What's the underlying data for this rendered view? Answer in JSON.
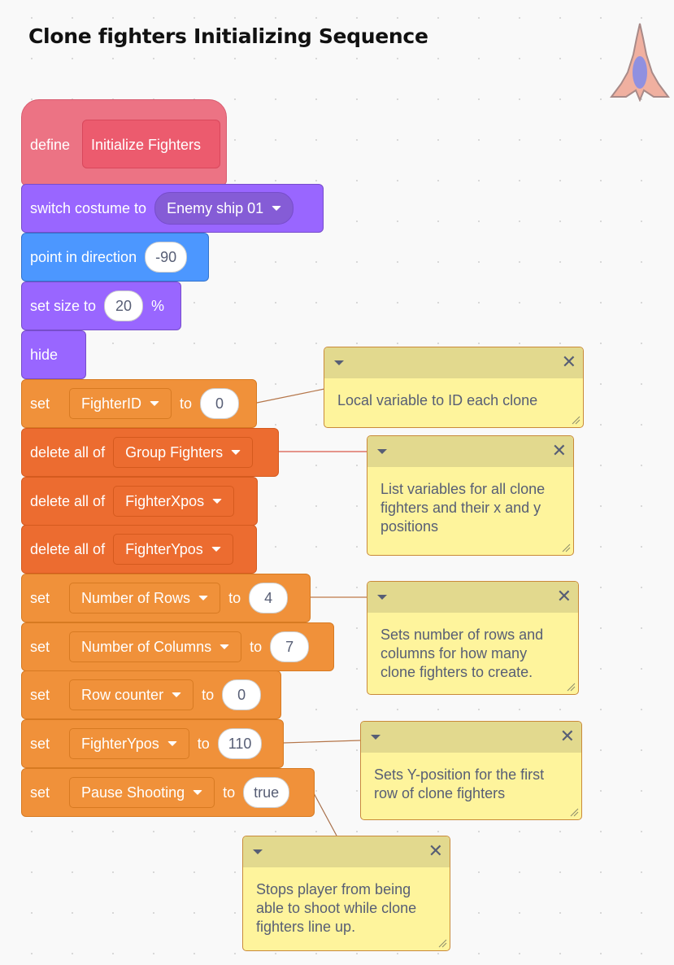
{
  "page": {
    "title": "Clone fighters Initializing Sequence"
  },
  "sprite": {
    "icon": "enemy-ship-sprite"
  },
  "script": {
    "define": {
      "label": "define",
      "name": "Initialize Fighters"
    },
    "blocks": [
      {
        "kind": "looks",
        "text": "switch costume to",
        "dropdown": "Enemy ship 01"
      },
      {
        "kind": "motion",
        "text": "point in direction",
        "value": "-90"
      },
      {
        "kind": "looks",
        "text": "set size to",
        "value": "20",
        "suffix": "%"
      },
      {
        "kind": "looks",
        "text": "hide"
      },
      {
        "kind": "variable",
        "text": "set",
        "variable": "FighterID",
        "to": "to",
        "value": "0"
      },
      {
        "kind": "list",
        "text": "delete all of",
        "list": "Group Fighters"
      },
      {
        "kind": "list",
        "text": "delete all of",
        "list": "FighterXpos"
      },
      {
        "kind": "list",
        "text": "delete all of",
        "list": "FighterYpos"
      },
      {
        "kind": "variable",
        "text": "set",
        "variable": "Number of Rows",
        "to": "to",
        "value": "4"
      },
      {
        "kind": "variable",
        "text": "set",
        "variable": "Number of Columns",
        "to": "to",
        "value": "7"
      },
      {
        "kind": "variable",
        "text": "set",
        "variable": "Row counter",
        "to": "to",
        "value": "0"
      },
      {
        "kind": "variable",
        "text": "set",
        "variable": "FighterYpos",
        "to": "to",
        "value": "110"
      },
      {
        "kind": "variable",
        "text": "set",
        "variable": "Pause Shooting",
        "to": "to",
        "value": "true"
      }
    ]
  },
  "comments": [
    {
      "text": "Local variable to ID each clone"
    },
    {
      "text": "List variables for all clone fighters and their x and y positions"
    },
    {
      "text": "Sets number of rows and columns for how many clone fighters to create."
    },
    {
      "text": "Sets Y-position for the first row of clone fighters"
    },
    {
      "text": "Stops player from being able to shoot while clone fighters line up."
    }
  ],
  "colors": {
    "looks": "#9966ff",
    "motion": "#4c97ff",
    "variables": "#ff8c1a",
    "lists": "#ff661a",
    "custom": "#ff6680",
    "comment": "#fef49c"
  }
}
